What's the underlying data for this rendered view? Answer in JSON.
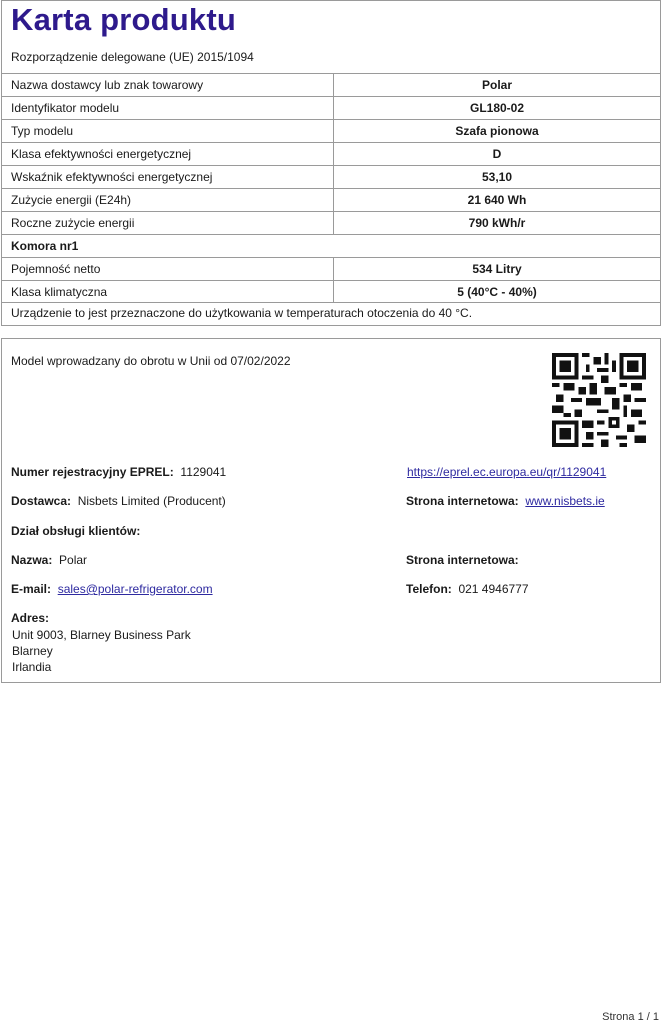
{
  "header": {
    "title": "Karta produktu",
    "subtitle": "Rozporządzenie delegowane (UE) 2015/1094"
  },
  "rows": [
    {
      "label": "Nazwa dostawcy lub znak towarowy",
      "value": "Polar"
    },
    {
      "label": "Identyfikator modelu",
      "value": "GL180-02"
    },
    {
      "label": "Typ modelu",
      "value": "Szafa pionowa"
    },
    {
      "label": "Klasa efektywności energetycznej",
      "value": "D"
    },
    {
      "label": "Wskaźnik efektywności energetycznej",
      "value": "53,10"
    },
    {
      "label": "Zużycie energii (E24h)",
      "value": "21 640 Wh"
    },
    {
      "label": "Roczne zużycie energii",
      "value": "790 kWh/r"
    },
    {
      "label": "Komora nr1",
      "value": ""
    },
    {
      "label": "Pojemność netto",
      "value": "534 Litry"
    },
    {
      "label": "Klasa klimatyczna",
      "value": "5 (40°C - 40%)"
    }
  ],
  "note": "Urządzenie to jest przeznaczone do użytkowania w temperaturach otoczenia do 40 °C.",
  "info": {
    "intro": "Model wprowadzany do obrotu w Unii od 07/02/2022",
    "eprel_label": "Numer rejestracyjny EPREL:",
    "eprel_value": "1129041",
    "eprel_link": "https://eprel.ec.europa.eu/qr/1129041",
    "supplier_label": "Dostawca:",
    "supplier_value": "Nisbets Limited (Producent)",
    "website_label": "Strona internetowa:",
    "website_value": "www.nisbets.ie",
    "service_label": "Dział obsługi klientów:",
    "name_label": "Nazwa:",
    "name_value": "Polar",
    "service_website_label": "Strona internetowa:",
    "email_label": "E-mail:",
    "email_value": "sales@polar-refrigerator.com",
    "phone_label": "Telefon:",
    "phone_value": "021 4946777",
    "address_label": "Adres:",
    "address_line1": "Unit 9003, Blarney Business Park",
    "address_line2": "Blarney",
    "address_line3": "Irlandia"
  },
  "footer": {
    "page": "Strona 1 / 1"
  }
}
